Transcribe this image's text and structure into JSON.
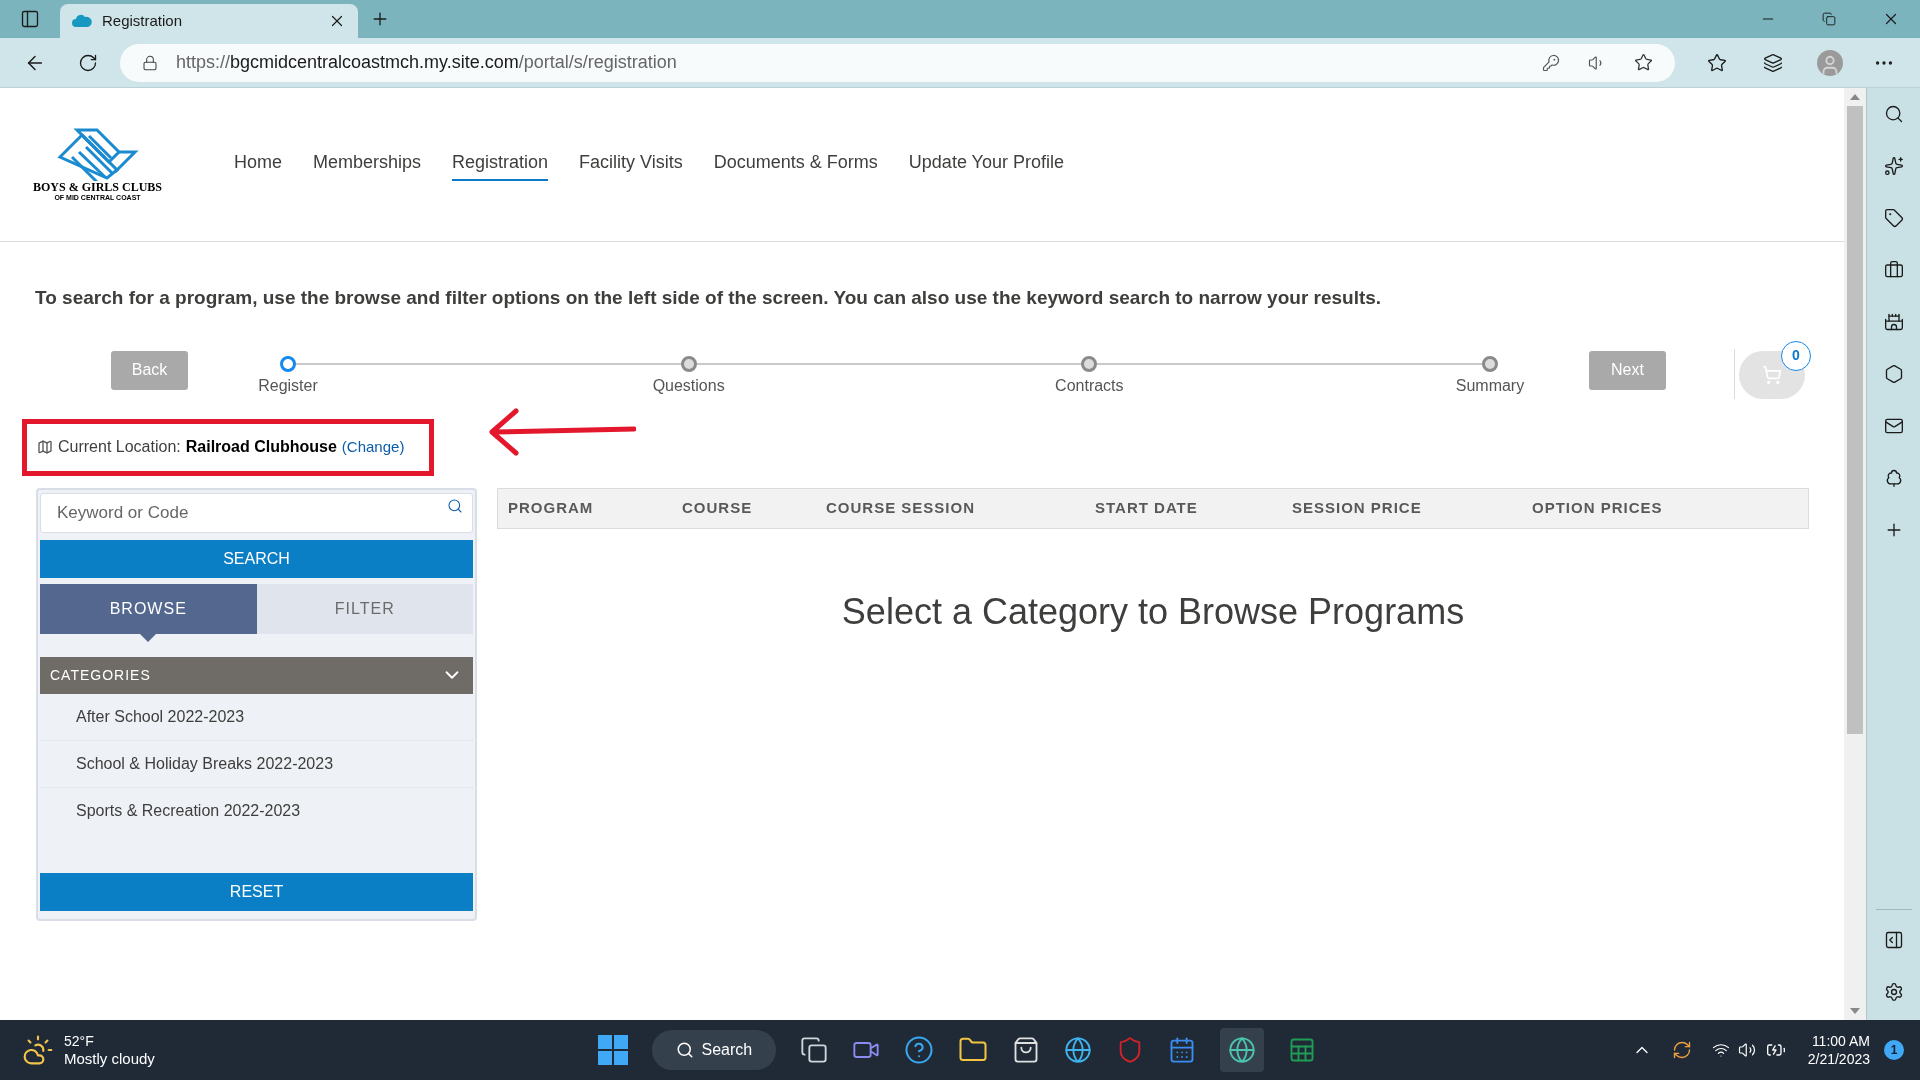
{
  "browser": {
    "tab_title": "Registration",
    "url": {
      "scheme": "https://",
      "host": "bgcmidcentralcoastmch.my.site.com",
      "path": "/portal/s/registration"
    }
  },
  "logo": {
    "line_1": "BOYS & GIRLS CLUBS",
    "line_2": "OF MID CENTRAL COAST"
  },
  "nav": [
    {
      "label": "Home",
      "selected": false
    },
    {
      "label": "Memberships",
      "selected": false
    },
    {
      "label": "Registration",
      "selected": true
    },
    {
      "label": "Facility Visits",
      "selected": false
    },
    {
      "label": "Documents & Forms",
      "selected": false
    },
    {
      "label": "Update Your Profile",
      "selected": false
    }
  ],
  "intro": "To search for a program, use the browse and filter options on the left side of the screen. You can also use the keyword search to narrow your results.",
  "back_button": "Back",
  "next_button": "Next",
  "cart_count": "0",
  "steps": [
    {
      "label": "Register",
      "selected": true
    },
    {
      "label": "Questions",
      "selected": false
    },
    {
      "label": "Contracts",
      "selected": false
    },
    {
      "label": "Summary",
      "selected": false
    }
  ],
  "location": {
    "label": "Current Location:",
    "value": "Railroad Clubhouse",
    "change_link": "(Change)"
  },
  "search": {
    "placeholder": "Keyword or Code",
    "button": "SEARCH"
  },
  "tabs": [
    {
      "label": "BROWSE",
      "selected": true
    },
    {
      "label": "FILTER",
      "selected": false
    }
  ],
  "categories": {
    "title": "CATEGORIES",
    "expanded": true,
    "items": [
      "After School 2022-2023",
      "School & Holiday Breaks 2022-2023",
      "Sports & Recreation 2022-2023"
    ]
  },
  "reset_button": "RESET",
  "table": {
    "columns": [
      "PROGRAM",
      "COURSE",
      "COURSE SESSION",
      "START DATE",
      "SESSION PRICE",
      "OPTION PRICES"
    ],
    "empty_message": "Select a Category to Browse Programs"
  },
  "taskbar": {
    "temperature": "52°F",
    "weather": "Mostly cloudy",
    "search": "Search",
    "time": "11:00 AM",
    "date": "2/21/2023",
    "notifications": "1"
  }
}
